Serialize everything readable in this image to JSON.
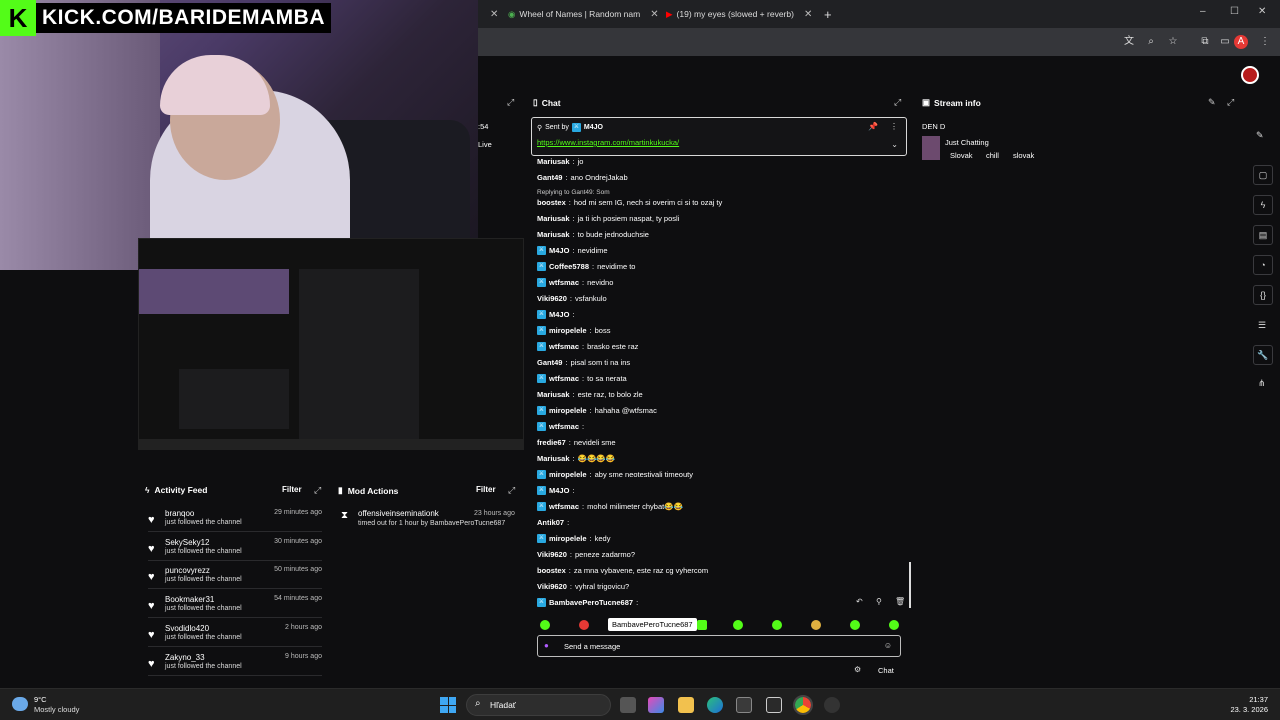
{
  "brand": {
    "url": "KICK.COM/BARIDEMAMBA",
    "logo_letter": "K"
  },
  "tabs": [
    {
      "label": "",
      "icon": "tab-close"
    },
    {
      "label": "Wheel of Names | Random nam",
      "icon": "wheel-icon"
    },
    {
      "label": "(19) my eyes (slowed + reverb)",
      "icon": "youtube-icon"
    }
  ],
  "window": {
    "minimize": "–",
    "maximize": "☐",
    "close": "✕",
    "new_tab": "+"
  },
  "left_fragments": {
    "a": ":54",
    "b": "Live"
  },
  "chat": {
    "header": "Chat",
    "pinned_by_label": "Sent by",
    "pinned_by_user": "M4JO",
    "pinned_link": "https://www.instagram.com/martinkukucka/",
    "reply_note": "Replying to Gant49: Som",
    "messages": [
      {
        "user": "Mariusak",
        "text": "jo",
        "mod": false
      },
      {
        "user": "Gant49",
        "text": "ano OndrejJakab",
        "mod": false
      },
      {
        "user": "boostex",
        "text": "hod mi sem IG, nech si overim ci si to ozaj ty",
        "mod": false
      },
      {
        "user": "Mariusak",
        "text": "ja ti ich posiem naspat, ty posli",
        "mod": false
      },
      {
        "user": "Mariusak",
        "text": "to bude jednoduchsie",
        "mod": false
      },
      {
        "user": "M4JO",
        "text": "nevidime",
        "mod": true
      },
      {
        "user": "Coffee5788",
        "text": "nevidime to",
        "mod": true
      },
      {
        "user": "wtfsmac",
        "text": "nevidno",
        "mod": true
      },
      {
        "user": "Viki9620",
        "text": "vsfankulo",
        "mod": false
      },
      {
        "user": "M4JO",
        "text": "",
        "mod": true
      },
      {
        "user": "miropelele",
        "text": "boss",
        "mod": true
      },
      {
        "user": "wtfsmac",
        "text": "brasko este raz",
        "mod": true
      },
      {
        "user": "Gant49",
        "text": "pisal som ti na ins",
        "mod": false
      },
      {
        "user": "wtfsmac",
        "text": "to sa nerata",
        "mod": true
      },
      {
        "user": "Mariusak",
        "text": "este raz, to bolo zle",
        "mod": false
      },
      {
        "user": "miropelele",
        "text": "hahaha @wtfsmac",
        "mod": true
      },
      {
        "user": "wtfsmac",
        "text": "",
        "mod": true
      },
      {
        "user": "fredie67",
        "text": "nevideli sme",
        "mod": false
      },
      {
        "user": "Mariusak",
        "text": "😂😂😂😂",
        "mod": false
      },
      {
        "user": "miropelele",
        "text": "aby sme neotestivali timeouty",
        "mod": true
      },
      {
        "user": "M4JO",
        "text": "",
        "mod": true
      },
      {
        "user": "wtfsmac",
        "text": "mohol milimeter chybat😂😂",
        "mod": true
      },
      {
        "user": "Antik07",
        "text": "",
        "mod": false
      },
      {
        "user": "miropelele",
        "text": "kedy",
        "mod": true
      },
      {
        "user": "Viki9620",
        "text": "peneze zadarmo?",
        "mod": false
      },
      {
        "user": "boostex",
        "text": "za mna vybavene, este raz cg vyhercom",
        "mod": false
      },
      {
        "user": "Viki9620",
        "text": "vyhral trigovicu?",
        "mod": false
      },
      {
        "user": "BambavePeroTucne687",
        "text": "",
        "mod": true
      }
    ],
    "tooltip": "BambavePeroTucne687",
    "input_placeholder": "Send a message",
    "chat_button": "Chat"
  },
  "stream_info": {
    "header": "Stream info",
    "title": "DEN D",
    "category": "Just Chatting",
    "tags": [
      "Slovak",
      "chill",
      "slovak"
    ]
  },
  "activity_feed": {
    "header": "Activity Feed",
    "filter": "Filter",
    "items": [
      {
        "name": "branqoo",
        "sub": "just followed the channel",
        "time": "29 minutes ago"
      },
      {
        "name": "SekySeky12",
        "sub": "just followed the channel",
        "time": "30 minutes ago"
      },
      {
        "name": "puncovyrezz",
        "sub": "just followed the channel",
        "time": "50 minutes ago"
      },
      {
        "name": "Bookmaker31",
        "sub": "just followed the channel",
        "time": "54 minutes ago"
      },
      {
        "name": "Svodidlo420",
        "sub": "just followed the channel",
        "time": "2 hours ago"
      },
      {
        "name": "Zakyno_33",
        "sub": "just followed the channel",
        "time": "9 hours ago"
      }
    ]
  },
  "mod_actions": {
    "header": "Mod Actions",
    "filter": "Filter",
    "items": [
      {
        "name": "offensiveinseminationk",
        "sub": "timed out for 1 hour by BambavePeroTucne687",
        "time": "23 hours ago"
      }
    ]
  },
  "taskbar": {
    "weather_temp": "9°C",
    "weather_desc": "Mostly cloudy",
    "search": "Hľadať",
    "time": "21:37",
    "date": "23. 3. 2026"
  },
  "colors": {
    "kick_green": "#53fc18",
    "mod_blue": "#29a9e1",
    "accent_red": "#e53935"
  }
}
